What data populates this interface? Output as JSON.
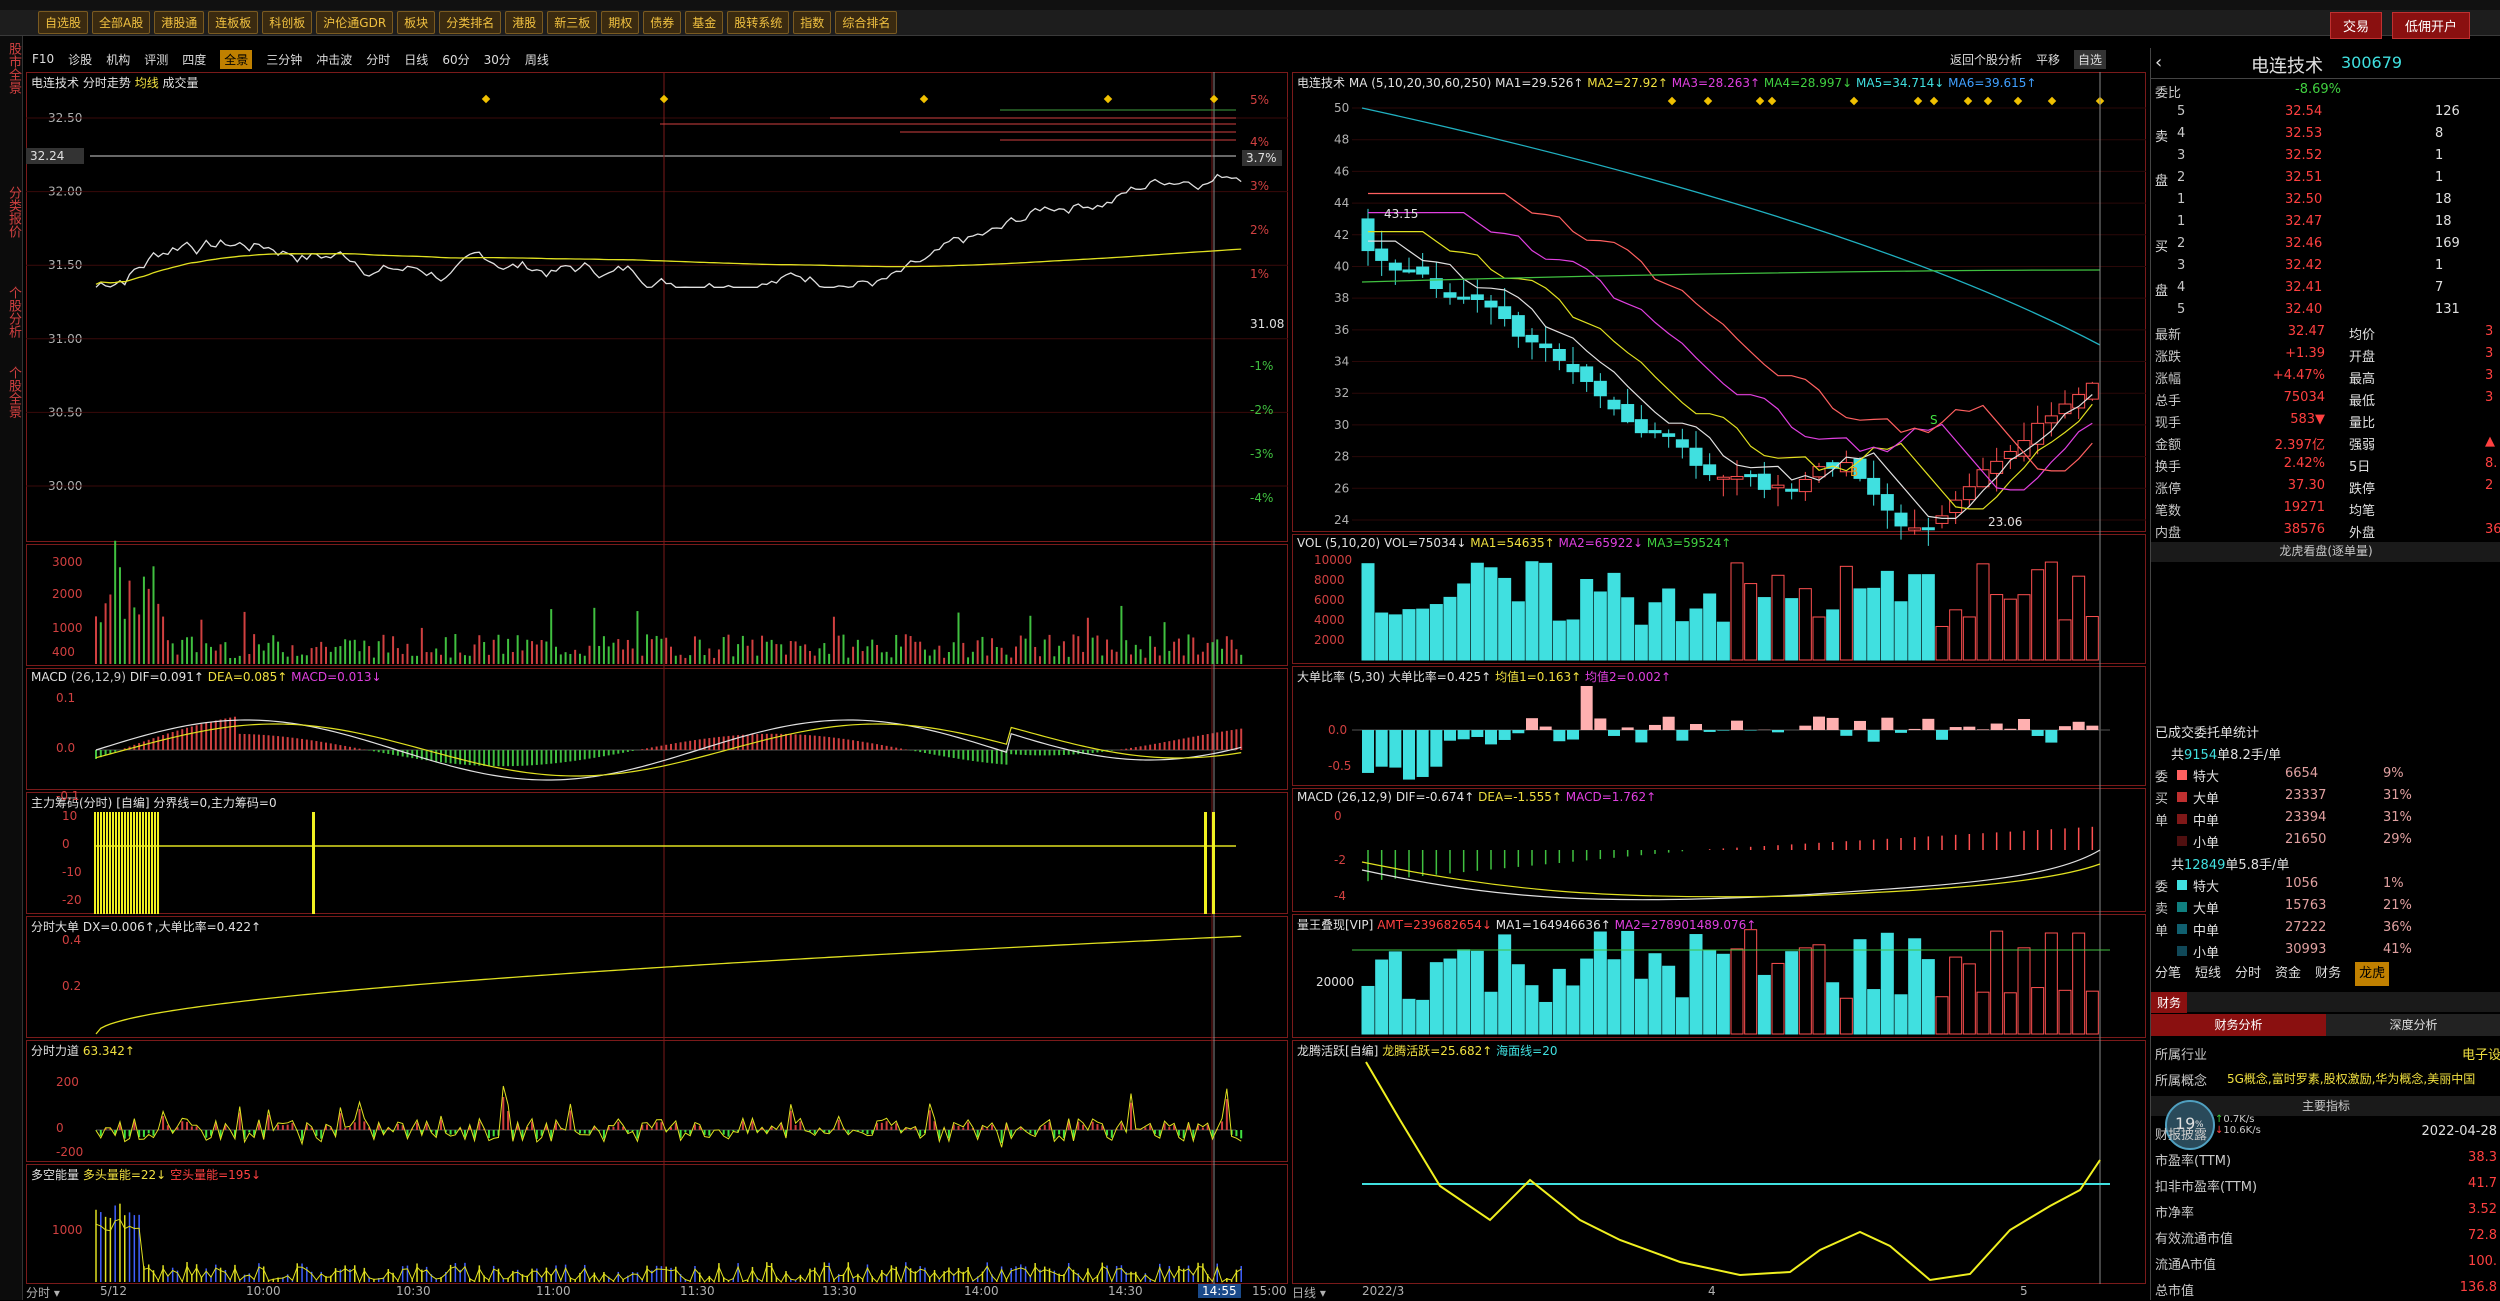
{
  "toolbar": {
    "buttons": [
      "自选股",
      "全部A股",
      "港股通",
      "连板板",
      "科创板",
      "沪伦通GDR",
      "板块",
      "分类排名",
      "港股",
      "新三板",
      "期权",
      "债券",
      "基金",
      "股转系统",
      "指数",
      "综合排名"
    ],
    "right_buttons": [
      "交易",
      "低佣开户"
    ]
  },
  "leftnav": {
    "tabs": [
      "股市全景",
      "分类报价",
      "个股分析",
      "个股全景"
    ]
  },
  "sub_toolbar": {
    "items": [
      "F10",
      "诊股",
      "机构",
      "评测",
      "四度",
      "全景",
      "三分钟",
      "冲击波",
      "分时",
      "日线",
      "60分",
      "30分",
      "周线"
    ],
    "active": "全景",
    "right": [
      "返回个股分析",
      "平移",
      "自选"
    ]
  },
  "intraday": {
    "header": {
      "name": "电连技术",
      "mode": "分时走势",
      "avg": "均线",
      "vol": "成交量"
    },
    "price_ticks": [
      "32.50",
      "32.00",
      "31.50",
      "31.00",
      "30.50",
      "30.00"
    ],
    "current_price": "32.24",
    "pct_ticks_up": [
      "5%",
      "4%",
      "3%",
      "2%",
      "1%"
    ],
    "pct_ticks_dn": [
      "-1%",
      "-2%",
      "-3%",
      "-4%"
    ],
    "pct_label": "3.7%",
    "prev_close": "31.08",
    "vol_ticks": [
      "3000",
      "2000",
      "1000",
      "400"
    ],
    "macd": {
      "title": "MACD",
      "params": "(26,12,9)",
      "dif": "DIF=0.091↑",
      "dea": "DEA=0.085↑",
      "macd": "MACD=0.013↓",
      "ticks": [
        "0.1",
        "0.0",
        "-0.1"
      ]
    },
    "zlcm": {
      "title": "主力筹码(分时)",
      "sub": "[自编]",
      "params": "分界线=0,主力筹码=0",
      "ticks": [
        "10",
        "0",
        "-10",
        "-20"
      ]
    },
    "dd": {
      "title": "分时大单",
      "params": "DX=0.006↑,大单比率=0.422↑",
      "ticks": [
        "0.4",
        "0.2"
      ]
    },
    "ld": {
      "title": "分时力道",
      "params": "63.342↑",
      "ticks": [
        "200",
        "0",
        "-200"
      ]
    },
    "dk": {
      "title": "多空能量",
      "params": "多头量能=22↓",
      "params2": "空头量能=195↓",
      "ticks": [
        "1000"
      ]
    },
    "time_ticks": [
      "5/12",
      "10:00",
      "10:30",
      "11:00",
      "11:30",
      "13:30",
      "14:00",
      "14:30",
      "15:00"
    ],
    "cursor_time": "14:55",
    "footer_left": "分时"
  },
  "kline": {
    "header": {
      "name": "电连技术",
      "ma": "MA",
      "params": "(5,10,20,30,60,250)",
      "ma1": "MA1=29.526↑",
      "ma2": "MA2=27.92↑",
      "ma3": "MA3=28.263↑",
      "ma4": "MA4=28.997↓",
      "ma5": "MA5=34.714↓",
      "ma6": "MA6=39.615↑"
    },
    "price_ticks": [
      "50",
      "48",
      "46",
      "44",
      "42",
      "40",
      "38",
      "36",
      "34",
      "32",
      "30",
      "28",
      "26",
      "24"
    ],
    "high_label": "43.15",
    "low_label": "23.06",
    "b_label": "B",
    "s_label": "S",
    "vol": {
      "title": "VOL",
      "params": "(5,10,20)",
      "v": "VOL=75034↓",
      "ma1": "MA1=54635↑",
      "ma2": "MA2=65922↓",
      "ma3": "MA3=59524↑",
      "ticks": [
        "10000",
        "8000",
        "6000",
        "4000",
        "2000"
      ]
    },
    "ddbl": {
      "title": "大单比率",
      "params": "(5,30)",
      "v": "大单比率=0.425↑",
      "m1": "均值1=0.163↑",
      "m2": "均值2=0.002↑",
      "ticks": [
        "0.0",
        "-0.5"
      ]
    },
    "macd": {
      "title": "MACD",
      "params": "(26,12,9)",
      "dif": "DIF=-0.674↑",
      "dea": "DEA=-1.555↑",
      "macd": "MACD=1.762↑",
      "ticks": [
        "0",
        "-2",
        "-4"
      ]
    },
    "lwjx": {
      "title": "量王叠现[VIP]",
      "amt": "AMT=239682654↓",
      "ma1": "MA1=164946636↑",
      "ma2": "MA2=278901489.076↑",
      "ticks": [
        "20000"
      ]
    },
    "lthy": {
      "title": "龙腾活跃[自编]",
      "v": "龙腾活跃=25.682↑",
      "line": "海面线=20"
    },
    "date_ticks": [
      "2022/3",
      "4",
      "5"
    ],
    "footer_left": "日线"
  },
  "side": {
    "name": "电连技术",
    "code": "300679",
    "weibi_label": "委比",
    "weibi": "-8.69%",
    "sell": [
      {
        "lv": "5",
        "p": "32.54",
        "v": "126"
      },
      {
        "lv": "4",
        "p": "32.53",
        "v": "8"
      },
      {
        "lv": "3",
        "p": "32.52",
        "v": "1"
      },
      {
        "lv": "2",
        "p": "32.51",
        "v": "1"
      },
      {
        "lv": "1",
        "p": "32.50",
        "v": "18"
      }
    ],
    "buy": [
      {
        "lv": "1",
        "p": "32.47",
        "v": "18"
      },
      {
        "lv": "2",
        "p": "32.46",
        "v": "169"
      },
      {
        "lv": "3",
        "p": "32.42",
        "v": "1"
      },
      {
        "lv": "4",
        "p": "32.41",
        "v": "7"
      },
      {
        "lv": "5",
        "p": "32.40",
        "v": "131"
      }
    ],
    "sell_tag": "卖",
    "buy_tag": "买",
    "pan": "盘",
    "quote": [
      {
        "l": "最新",
        "v": "32.47",
        "l2": "均价",
        "v2": "3"
      },
      {
        "l": "涨跌",
        "v": "+1.39",
        "l2": "开盘",
        "v2": "3"
      },
      {
        "l": "涨幅",
        "v": "+4.47%",
        "l2": "最高",
        "v2": "3"
      },
      {
        "l": "总手",
        "v": "75034",
        "l2": "最低",
        "v2": "3"
      },
      {
        "l": "现手",
        "v": "583▼",
        "l2": "量比",
        "v2": ""
      },
      {
        "l": "金额",
        "v": "2.397亿",
        "l2": "强弱",
        "v2": "▲"
      },
      {
        "l": "换手",
        "v": "2.42%",
        "l2": "5日",
        "v2": "8."
      },
      {
        "l": "涨停",
        "v": "37.30",
        "l2": "跌停",
        "v2": "2"
      },
      {
        "l": "笔数",
        "v": "19271",
        "l2": "均笔",
        "v2": ""
      },
      {
        "l": "内盘",
        "v": "38576",
        "l2": "外盘",
        "v2": "36"
      }
    ],
    "lhkp": "龙虎看盘(逐单量)",
    "done_title": "已成交委托单统计",
    "buy_summary": {
      "prefix": "共",
      "n": "9154",
      "suffix": "单8.2手/单"
    },
    "buy_rows": [
      {
        "t": "特大",
        "v": "6654",
        "p": "9%"
      },
      {
        "t": "大单",
        "v": "23337",
        "p": "31%"
      },
      {
        "t": "中单",
        "v": "23394",
        "p": "31%"
      },
      {
        "t": "小单",
        "v": "21650",
        "p": "29%"
      }
    ],
    "sell_summary": {
      "prefix": "共",
      "n": "12849",
      "suffix": "单5.8手/单"
    },
    "sell_rows": [
      {
        "t": "特大",
        "v": "1056",
        "p": "1%"
      },
      {
        "t": "大单",
        "v": "15763",
        "p": "21%"
      },
      {
        "t": "中单",
        "v": "27222",
        "p": "36%"
      },
      {
        "t": "小单",
        "v": "30993",
        "p": "41%"
      }
    ],
    "side_tags_buy": [
      "委",
      "买",
      "单"
    ],
    "side_tags_sell": [
      "委",
      "卖",
      "单"
    ],
    "tabs": [
      "分笔",
      "短线",
      "分时",
      "资金",
      "财务",
      "龙虎"
    ],
    "active_tab": "龙虎",
    "fin_tab": "财务",
    "fin_tabs": [
      "财务分析",
      "深度分析"
    ],
    "industry_label": "所属行业",
    "industry": "电子设",
    "concept_label": "所属概念",
    "concept": "5G概念,富时罗素,股权激励,华为概念,美丽中国",
    "main_indicator": "主要指标",
    "report_label": "财报披露",
    "report_date": "2022-04-28",
    "net": {
      "pct": "19",
      "unit": "%",
      "up": "0.7",
      "down": "10.6",
      "u": "K/s"
    },
    "fin_rows": [
      {
        "l": "市盈率(TTM)",
        "v": "38.3"
      },
      {
        "l": "扣非市盈率(TTM)",
        "v": "41.7"
      },
      {
        "l": "市净率",
        "v": "3.52"
      },
      {
        "l": "有效流通市值",
        "v": "72.8"
      },
      {
        "l": "流通A市值",
        "v": "100."
      },
      {
        "l": "总市值",
        "v": "136.8"
      }
    ]
  }
}
